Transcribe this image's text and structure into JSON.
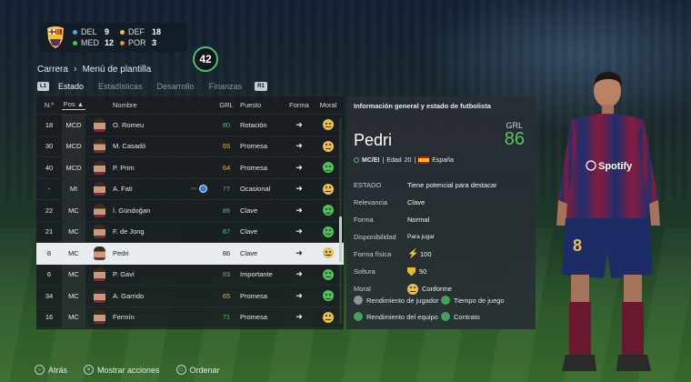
{
  "header": {
    "positions": [
      {
        "label": "DEL",
        "count": "9",
        "color": "#58a6e8"
      },
      {
        "label": "DEF",
        "count": "18",
        "color": "#e7c14b"
      },
      {
        "label": "MED",
        "count": "12",
        "color": "#4cc25a"
      },
      {
        "label": "POR",
        "count": "3",
        "color": "#e28a3a"
      }
    ],
    "total": "42"
  },
  "breadcrumb": {
    "root": "Carrera",
    "current": "Menú de plantilla"
  },
  "tabs": {
    "left_hint": "L1",
    "right_hint": "R1",
    "items": [
      "Estado",
      "Estadísticas",
      "Desarrollo",
      "Finanzas"
    ],
    "active": "Estado"
  },
  "table": {
    "headers": {
      "num": "N.º",
      "pos": "Pos",
      "name": "Nombre",
      "grl": "GRL",
      "role": "Puesto",
      "form": "Forma",
      "moral": "Moral"
    },
    "rows": [
      {
        "num": "18",
        "pos": "MCD",
        "name": "O. Romeu",
        "grl": "80",
        "grl_color": "#4fbf6c",
        "role": "Rotación",
        "form": "➜",
        "moral": "neutral"
      },
      {
        "num": "30",
        "pos": "MCD",
        "name": "M. Casadó",
        "grl": "65",
        "grl_color": "#e8b82c",
        "role": "Promesa",
        "form": "➜",
        "moral": "neutral"
      },
      {
        "num": "40",
        "pos": "MCD",
        "name": "P. Prim",
        "grl": "64",
        "grl_color": "#e8b82c",
        "role": "Promesa",
        "form": "➜",
        "moral": "happy"
      },
      {
        "num": "-",
        "pos": "MI",
        "name": "A. Fati",
        "grl": "77",
        "grl_color": "#4fbf6c",
        "role": "Ocasional",
        "form": "➜",
        "moral": "neutral",
        "loan": true
      },
      {
        "num": "22",
        "pos": "MC",
        "name": "İ. Gündoğan",
        "grl": "86",
        "grl_color": "#4fbf6c",
        "role": "Clave",
        "form": "➜",
        "moral": "happy"
      },
      {
        "num": "21",
        "pos": "MC",
        "name": "F. de Jong",
        "grl": "87",
        "grl_color": "#4fbf6c",
        "role": "Clave",
        "form": "➜",
        "moral": "happy"
      },
      {
        "num": "8",
        "pos": "MC",
        "name": "Pedri",
        "grl": "86",
        "grl_color": "#151a1f",
        "role": "Clave",
        "form": "➜",
        "moral": "neutral",
        "selected": true
      },
      {
        "num": "6",
        "pos": "MC",
        "name": "P. Gavi",
        "grl": "83",
        "grl_color": "#4fbf6c",
        "role": "Importante",
        "form": "➜",
        "moral": "happy"
      },
      {
        "num": "34",
        "pos": "MC",
        "name": "A. Garrido",
        "grl": "65",
        "grl_color": "#e8b82c",
        "role": "Promesa",
        "form": "➜",
        "moral": "happy"
      },
      {
        "num": "16",
        "pos": "MC",
        "name": "Fermín",
        "grl": "71",
        "grl_color": "#4fbf6c",
        "role": "Promesa",
        "form": "➜",
        "moral": "neutral"
      }
    ]
  },
  "info": {
    "title": "Información general y estado de futbolista",
    "name": "Pedri",
    "grl_label": "GRL",
    "grl": "86",
    "pos": "MC/EI",
    "age_label": "Edad",
    "age": "20",
    "nation": "España",
    "attributes": [
      {
        "key": "ESTADO",
        "value": "Tiene potencial para destacar"
      },
      {
        "key": "Relevancia",
        "value": "Clave"
      },
      {
        "key": "Forma",
        "value": "Normal"
      },
      {
        "key": "Disponibilidad",
        "value": "Para jugar"
      },
      {
        "key": "Forma física",
        "value": "100"
      },
      {
        "key": "Soltura",
        "value": "50"
      },
      {
        "key": "Moral",
        "value": "Conforme"
      }
    ],
    "legend": [
      {
        "label": "Rendimiento de jugador",
        "color": "grey"
      },
      {
        "label": "Tiempo de juego",
        "color": "green"
      },
      {
        "label": "Rendimiento del equipo",
        "color": "green"
      },
      {
        "label": "Contrato",
        "color": "green"
      }
    ]
  },
  "footer": {
    "back": "Atrás",
    "actions": "Mostrar acciones",
    "sort": "Ordenar"
  },
  "player_shirt_number": "8",
  "sponsor": "Spotify"
}
